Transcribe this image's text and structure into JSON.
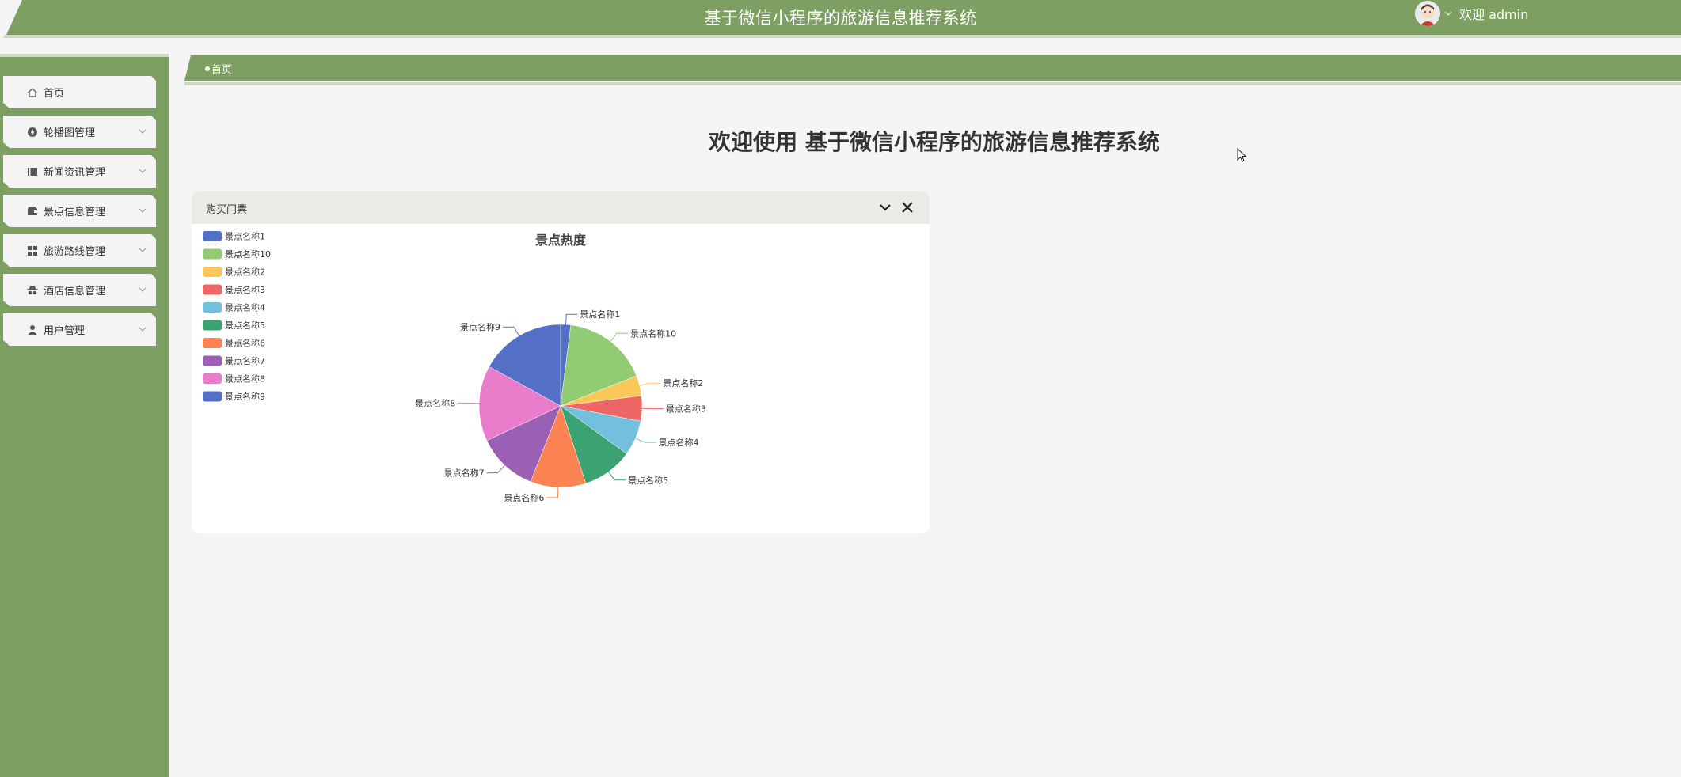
{
  "header": {
    "title": "基于微信小程序的旅游信息推荐系统",
    "welcome": "欢迎 admin"
  },
  "sidebar": {
    "items": [
      {
        "label": "首页",
        "icon": "home-icon",
        "has_children": false
      },
      {
        "label": "轮播图管理",
        "icon": "disc-icon",
        "has_children": true
      },
      {
        "label": "新闻资讯管理",
        "icon": "book-icon",
        "has_children": true
      },
      {
        "label": "景点信息管理",
        "icon": "wallet-icon",
        "has_children": true
      },
      {
        "label": "旅游路线管理",
        "icon": "grid-icon",
        "has_children": true
      },
      {
        "label": "酒店信息管理",
        "icon": "incognito-icon",
        "has_children": true
      },
      {
        "label": "用户管理",
        "icon": "user-icon",
        "has_children": true
      }
    ]
  },
  "breadcrumb": {
    "items": [
      "首页"
    ]
  },
  "main": {
    "welcome_title": "欢迎使用 基于微信小程序的旅游信息推荐系统"
  },
  "card": {
    "title": "购买门票",
    "collapse_icon": "chevron-down-icon",
    "close_icon": "close-icon"
  },
  "colors": {
    "brand": "#7d9f61",
    "card_header": "#e9ece6"
  },
  "chart_data": {
    "type": "pie",
    "title": "景点热度",
    "legend_position": "top-left",
    "series": [
      {
        "name": "景点名称1",
        "value": 2,
        "color": "#5470c6"
      },
      {
        "name": "景点名称10",
        "value": 17,
        "color": "#91cc75"
      },
      {
        "name": "景点名称2",
        "value": 4,
        "color": "#fac858"
      },
      {
        "name": "景点名称3",
        "value": 5,
        "color": "#ee6666"
      },
      {
        "name": "景点名称4",
        "value": 7,
        "color": "#73c0de"
      },
      {
        "name": "景点名称5",
        "value": 10,
        "color": "#3ba272"
      },
      {
        "name": "景点名称6",
        "value": 11,
        "color": "#fc8452"
      },
      {
        "name": "景点名称7",
        "value": 12,
        "color": "#9a60b4"
      },
      {
        "name": "景点名称8",
        "value": 15,
        "color": "#ea7ccc"
      },
      {
        "name": "景点名称9",
        "value": 17,
        "color": "#5470c6"
      }
    ]
  }
}
